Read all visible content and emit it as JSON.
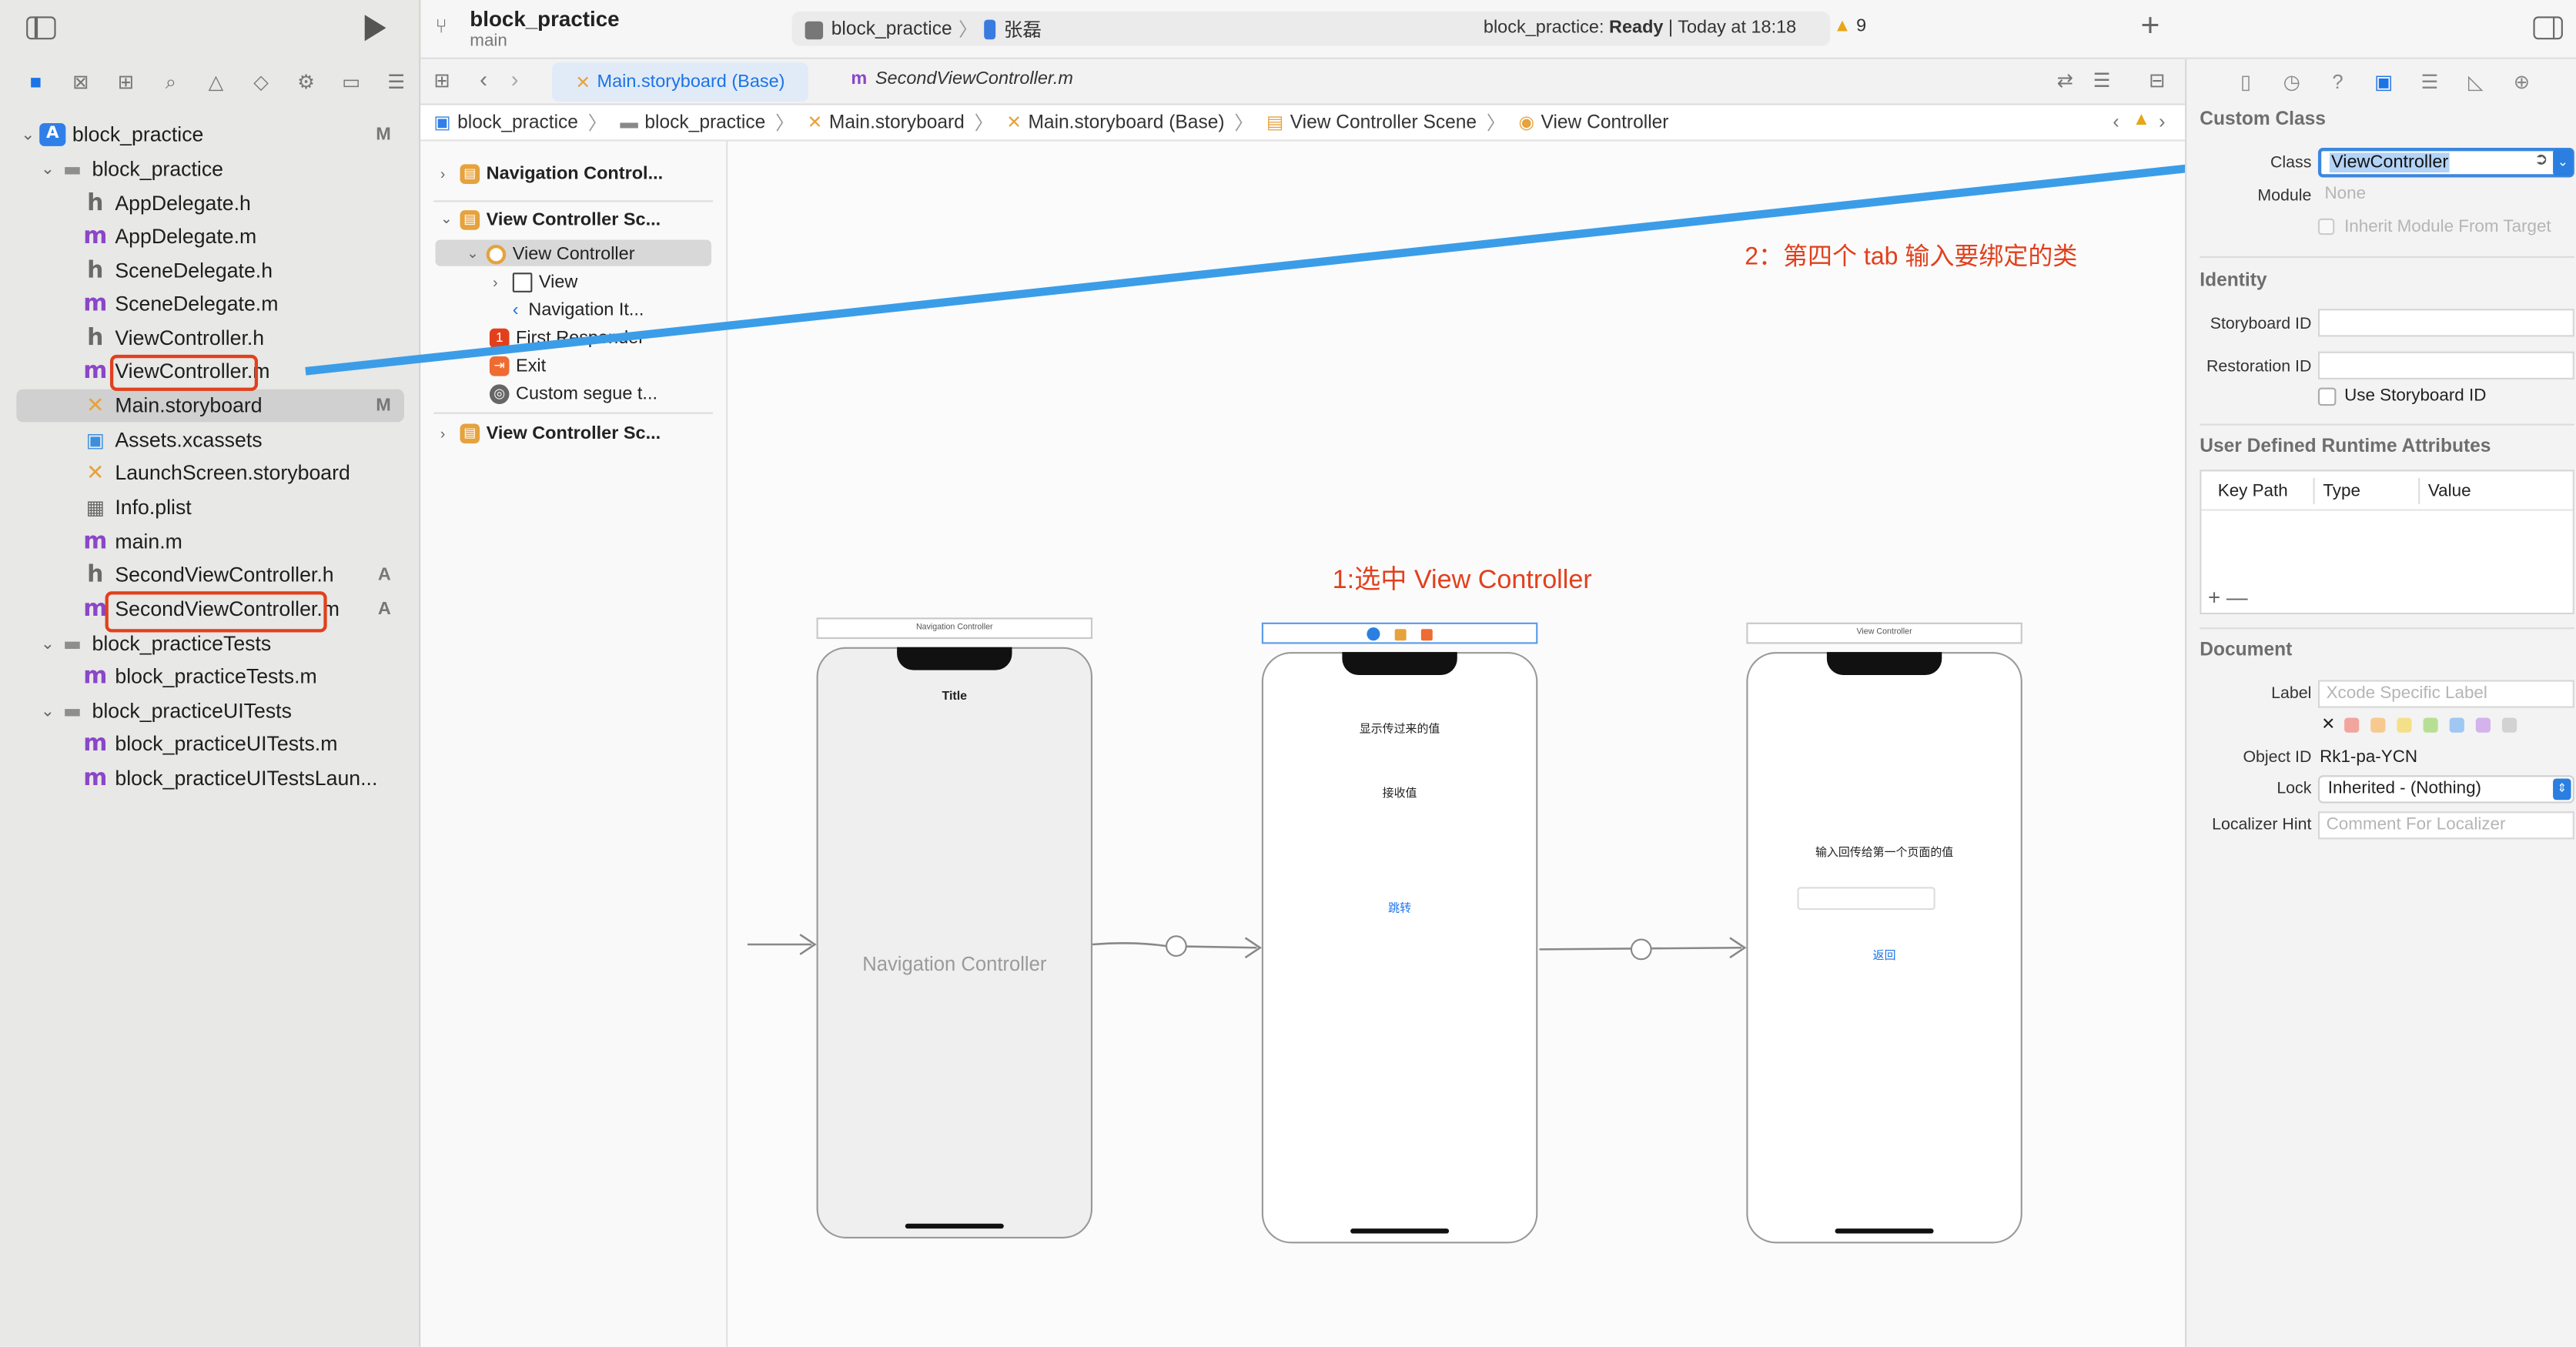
{
  "toolbar": {
    "project": "block_practice",
    "branch": "main",
    "scheme_target": "block_practice",
    "device": "张磊",
    "status_project": "block_practice:",
    "status_state": "Ready",
    "status_time": "| Today at 18:18",
    "warning_count": "9",
    "add": "+"
  },
  "navigator": {
    "tabs": [
      "folder-icon",
      "source-control-icon",
      "hierarchy-icon",
      "search-icon",
      "warning-icon",
      "test-icon",
      "debug-icon",
      "breakpoint-icon",
      "report-icon"
    ],
    "items": [
      {
        "label": "block_practice",
        "badge": "M"
      },
      {
        "label": "block_practice",
        "badge": ""
      },
      {
        "label": "AppDelegate.h",
        "badge": ""
      },
      {
        "label": "AppDelegate.m",
        "badge": ""
      },
      {
        "label": "SceneDelegate.h",
        "badge": ""
      },
      {
        "label": "SceneDelegate.m",
        "badge": ""
      },
      {
        "label": "ViewController.h",
        "badge": ""
      },
      {
        "label": "ViewController.m",
        "badge": ""
      },
      {
        "label": "Main.storyboard",
        "badge": "M"
      },
      {
        "label": "Assets.xcassets",
        "badge": ""
      },
      {
        "label": "LaunchScreen.storyboard",
        "badge": ""
      },
      {
        "label": "Info.plist",
        "badge": ""
      },
      {
        "label": "main.m",
        "badge": ""
      },
      {
        "label": "SecondViewController.h",
        "badge": "A"
      },
      {
        "label": "SecondViewController.m",
        "badge": "A"
      },
      {
        "label": "block_practiceTests",
        "badge": ""
      },
      {
        "label": "block_practiceTests.m",
        "badge": ""
      },
      {
        "label": "block_practiceUITests",
        "badge": ""
      },
      {
        "label": "block_practiceUITests.m",
        "badge": ""
      },
      {
        "label": "block_practiceUITestsLaun...",
        "badge": ""
      }
    ]
  },
  "editor": {
    "tab_active": "Main.storyboard (Base)",
    "tab_inactive": "SecondViewController.m",
    "breadcrumbs": [
      "block_practice",
      "block_practice",
      "Main.storyboard",
      "Main.storyboard (Base)",
      "View Controller Scene",
      "View Controller"
    ]
  },
  "outline": {
    "items": [
      "Navigation Control...",
      "View Controller Sc...",
      "View Controller",
      "View",
      "Navigation It...",
      "First Responder",
      "Exit",
      "Custom segue t...",
      "View Controller Sc..."
    ]
  },
  "canvas": {
    "nav_scene_title": "Navigation Controller",
    "nav_title": "Title",
    "nav_center_label": "Navigation Controller",
    "vc1_label_1": "显示传过来的值",
    "vc1_label_2": "接收值",
    "vc1_button": "跳转",
    "vc2_scene_title": "View Controller",
    "vc2_label": "输入回传给第一个页面的值",
    "vc2_button": "返回",
    "annotation_1": "1:选中 View Controller",
    "annotation_2": "2：第四个 tab 输入要绑定的类"
  },
  "inspector": {
    "custom_class_title": "Custom Class",
    "class_label": "Class",
    "class_value": "ViewController",
    "module_label": "Module",
    "module_value": "None",
    "inherit_label": "Inherit Module From Target",
    "identity_title": "Identity",
    "storyboard_id_label": "Storyboard ID",
    "restoration_id_label": "Restoration ID",
    "use_storyboard_id": "Use Storyboard ID",
    "udra_title": "User Defined Runtime Attributes",
    "col_key_path": "Key Path",
    "col_type": "Type",
    "col_value": "Value",
    "add_remove": "+ —",
    "document_title": "Document",
    "label_label": "Label",
    "label_placeholder": "Xcode Specific Label",
    "object_id_label": "Object ID",
    "object_id_value": "Rk1-pa-YCN",
    "lock_label": "Lock",
    "lock_value": "Inherited - (Nothing)",
    "localizer_label": "Localizer Hint",
    "localizer_placeholder": "Comment For Localizer",
    "label_colors": [
      "#f2a59d",
      "#f7c98f",
      "#f5e08a",
      "#b7df94",
      "#9fc7f2",
      "#d4b3ec",
      "#d2d2d2"
    ]
  },
  "colors": {
    "accent": "#1b73e8",
    "annotation": "#e2401c",
    "arrow": "#3b9de8"
  }
}
